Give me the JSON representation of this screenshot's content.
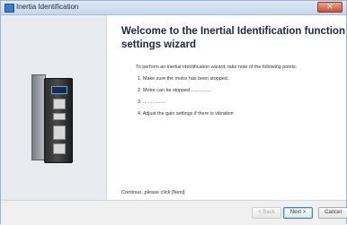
{
  "window": {
    "title": "Inertia Identification"
  },
  "titlebar": {
    "close_glyph": "✕"
  },
  "content": {
    "heading": "Welcome to the Inertial Identification function settings wizard",
    "intro": "To perform an inertial identification wizard, take note of the following points:",
    "steps": [
      "1. Make sure the motor has been stopped.",
      "2. Motor can be stopped ...............",
      "3. .................",
      "4. Adjust the gain settings if there is vibration"
    ],
    "continue_text": "Continue, please click [Next]"
  },
  "footer": {
    "back_label": "< Back",
    "next_label": "Next >",
    "cancel_label": "Cancel"
  }
}
